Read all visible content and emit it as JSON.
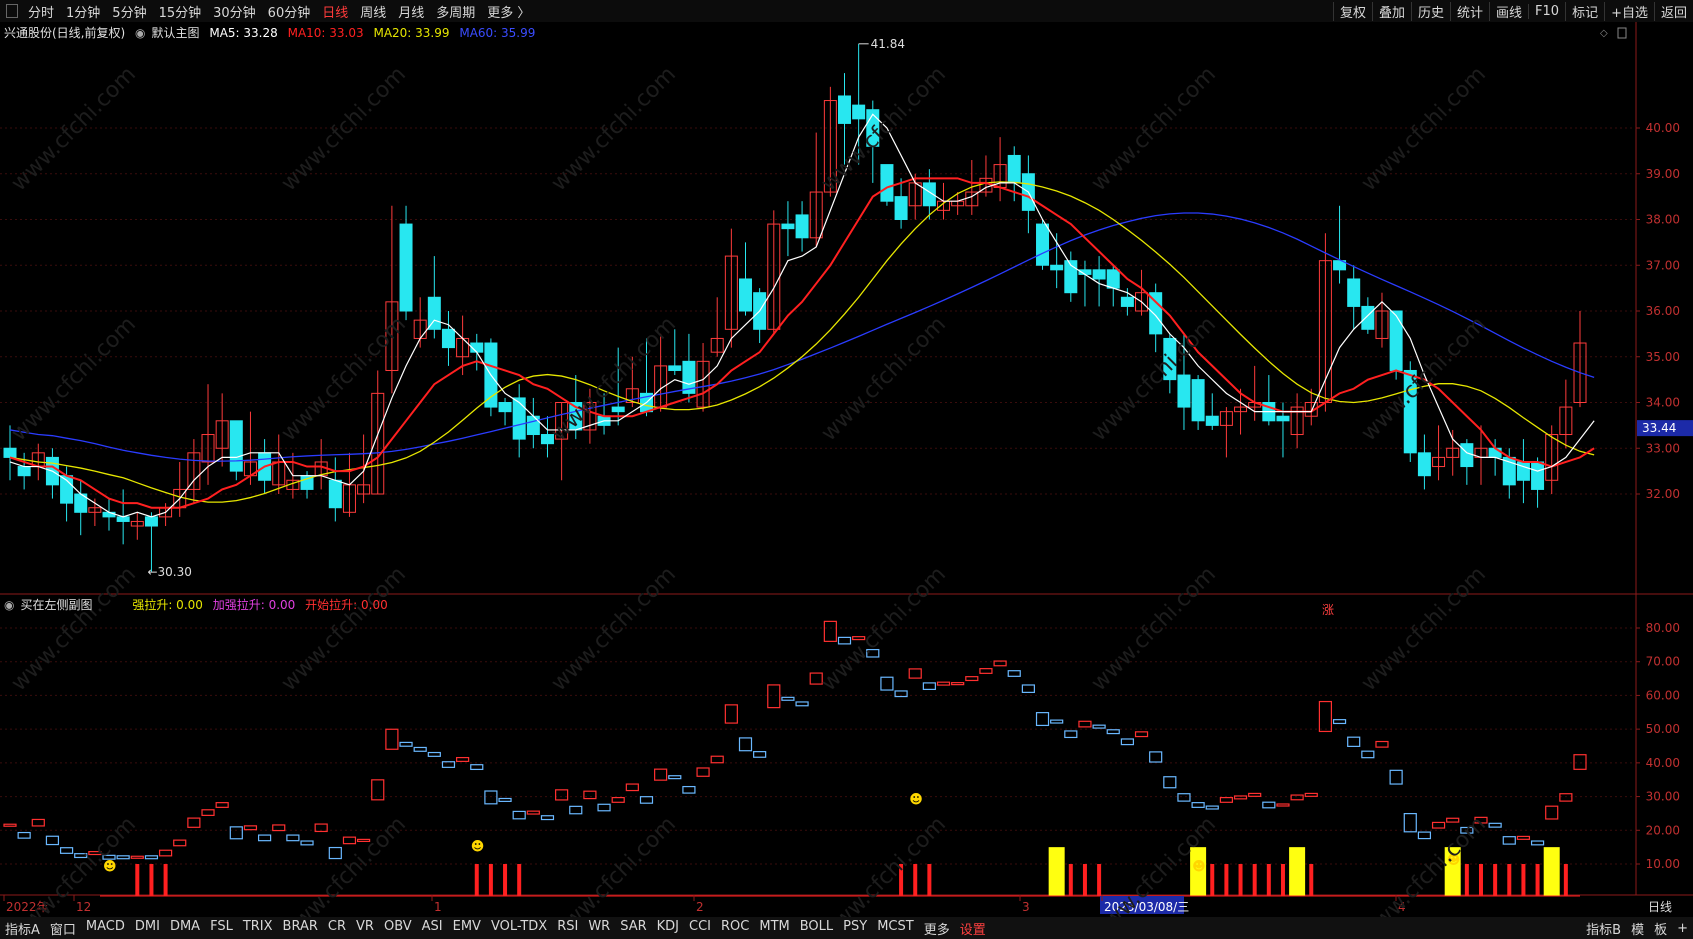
{
  "toolbar": {
    "timeframes": [
      "分时",
      "1分钟",
      "5分钟",
      "15分钟",
      "30分钟",
      "60分钟",
      "日线",
      "周线",
      "月线",
      "多周期",
      "更多 〉"
    ],
    "active": "日线",
    "right_buttons": [
      "复权",
      "叠加",
      "历史",
      "统计",
      "画线",
      "F10",
      "标记",
      "+自选",
      "返回"
    ]
  },
  "main_chart": {
    "stock_title": "兴通股份(日线,前复权)",
    "template": "默认主图",
    "ma5": "MA5: 33.28",
    "ma10": "MA10: 33.03",
    "ma20": "MA20: 33.99",
    "ma60": "MA60: 35.99",
    "high_label": "41.84",
    "low_label": "←30.30",
    "current_price": "33.44",
    "zhang": "涨",
    "y_ticks": [
      "40.00",
      "39.00",
      "38.00",
      "37.00",
      "36.00",
      "35.00",
      "34.00",
      "33.00",
      "32.00"
    ],
    "colors": {
      "up": "#ff3b3b",
      "down": "#28e7f0",
      "ma5": "#ffffff",
      "ma10": "#ff2020",
      "ma20": "#e6e600",
      "ma60": "#2a3cff"
    }
  },
  "sub_chart": {
    "title": "买在左侧副图",
    "strong": "强拉升: 0.00",
    "accel": "加强拉升: 0.00",
    "start": "开始拉升: 0.00",
    "y_ticks": [
      "80.00",
      "70.00",
      "60.00",
      "50.00",
      "40.00",
      "30.00",
      "20.00",
      "10.00"
    ]
  },
  "x_axis": {
    "labels": [
      "2022年",
      "12",
      "1",
      "2",
      "3",
      "2023/03/08/三",
      "4"
    ],
    "period": "日线"
  },
  "bottom_bar": {
    "indicators": [
      "指标A",
      "窗口",
      "MACD",
      "DMI",
      "DMA",
      "FSL",
      "TRIX",
      "BRAR",
      "CR",
      "VR",
      "OBV",
      "ASI",
      "EMV",
      "VOL-TDX",
      "RSI",
      "WR",
      "SAR",
      "KDJ",
      "CCI",
      "ROC",
      "MTM",
      "BOLL",
      "PSY",
      "MCST",
      "更多",
      "设置"
    ],
    "right": [
      "指标B",
      "模",
      "板",
      "+"
    ]
  },
  "watermark": "www.cfchi.com",
  "chart_data": {
    "type": "candlestick",
    "ylim": [
      31.0,
      42.5
    ],
    "candles": [
      [
        33.0,
        32.8,
        33.5,
        32.3
      ],
      [
        32.6,
        32.4,
        32.9,
        32.1
      ],
      [
        32.6,
        32.9,
        33.1,
        32.3
      ],
      [
        32.8,
        32.2,
        33.0,
        31.9
      ],
      [
        32.4,
        31.8,
        32.6,
        31.4
      ],
      [
        32.0,
        31.6,
        32.3,
        31.1
      ],
      [
        31.6,
        31.7,
        31.9,
        31.3
      ],
      [
        31.6,
        31.5,
        31.9,
        31.2
      ],
      [
        31.5,
        31.4,
        32.1,
        30.9
      ],
      [
        31.3,
        31.4,
        31.6,
        31.0
      ],
      [
        31.5,
        31.3,
        31.6,
        30.3
      ],
      [
        31.5,
        31.7,
        31.8,
        31.3
      ],
      [
        31.7,
        32.1,
        32.7,
        31.5
      ],
      [
        32.1,
        32.9,
        33.2,
        31.8
      ],
      [
        32.7,
        33.3,
        34.4,
        32.2
      ],
      [
        33.0,
        33.6,
        34.2,
        32.6
      ],
      [
        33.6,
        32.5,
        33.6,
        32.3
      ],
      [
        32.4,
        32.7,
        33.8,
        32.2
      ],
      [
        32.9,
        32.3,
        33.2,
        32.0
      ],
      [
        32.2,
        32.7,
        33.3,
        32.0
      ],
      [
        32.1,
        32.3,
        32.9,
        31.9
      ],
      [
        32.4,
        32.1,
        32.5,
        31.9
      ],
      [
        32.4,
        32.7,
        33.2,
        32.1
      ],
      [
        32.3,
        31.7,
        32.8,
        31.4
      ],
      [
        31.6,
        32.2,
        32.9,
        31.5
      ],
      [
        32.0,
        32.2,
        33.3,
        31.8
      ],
      [
        32.0,
        34.2,
        34.7,
        32.0
      ],
      [
        34.7,
        36.2,
        38.3,
        34.2
      ],
      [
        37.9,
        36.0,
        38.3,
        35.8
      ],
      [
        35.4,
        35.8,
        36.3,
        35.2
      ],
      [
        36.3,
        35.6,
        37.2,
        35.4
      ],
      [
        35.6,
        35.2,
        36.0,
        34.8
      ],
      [
        35.0,
        35.4,
        35.9,
        34.6
      ],
      [
        35.3,
        35.1,
        35.5,
        34.7
      ],
      [
        35.3,
        33.9,
        35.4,
        33.7
      ],
      [
        34.0,
        33.8,
        34.1,
        33.5
      ],
      [
        34.1,
        33.2,
        34.4,
        32.8
      ],
      [
        33.7,
        33.3,
        34.1,
        33.0
      ],
      [
        33.3,
        33.1,
        33.7,
        32.8
      ],
      [
        33.2,
        34.0,
        34.0,
        32.3
      ],
      [
        34.0,
        33.4,
        34.6,
        33.2
      ],
      [
        33.4,
        34.0,
        34.3,
        33.1
      ],
      [
        33.7,
        33.5,
        34.2,
        33.3
      ],
      [
        33.9,
        33.8,
        35.2,
        33.5
      ],
      [
        34.0,
        34.3,
        35.0,
        33.9
      ],
      [
        34.2,
        33.8,
        35.4,
        33.7
      ],
      [
        33.9,
        34.8,
        35.5,
        33.8
      ],
      [
        34.8,
        34.7,
        35.6,
        34.6
      ],
      [
        34.9,
        34.2,
        35.5,
        34.0
      ],
      [
        33.9,
        34.9,
        35.3,
        33.8
      ],
      [
        35.1,
        35.4,
        36.3,
        35.0
      ],
      [
        35.6,
        37.2,
        37.8,
        35.2
      ],
      [
        36.7,
        36.0,
        37.5,
        35.9
      ],
      [
        36.4,
        35.6,
        36.5,
        35.3
      ],
      [
        35.6,
        37.9,
        38.2,
        35.5
      ],
      [
        37.9,
        37.8,
        38.4,
        37.2
      ],
      [
        38.1,
        37.6,
        38.4,
        37.3
      ],
      [
        37.6,
        38.6,
        39.9,
        37.4
      ],
      [
        38.6,
        40.6,
        40.9,
        38.5
      ],
      [
        40.7,
        40.1,
        41.2,
        39.2
      ],
      [
        40.5,
        40.2,
        41.84,
        39.2
      ],
      [
        40.4,
        39.6,
        40.6,
        38.8
      ],
      [
        39.2,
        38.4,
        39.2,
        38.3
      ],
      [
        38.5,
        38.0,
        38.9,
        37.8
      ],
      [
        38.3,
        38.8,
        39.0,
        38.0
      ],
      [
        38.8,
        38.3,
        39.1,
        38.0
      ],
      [
        38.2,
        38.4,
        38.8,
        38.0
      ],
      [
        38.3,
        38.4,
        38.6,
        38.1
      ],
      [
        38.3,
        38.6,
        39.3,
        38.1
      ],
      [
        38.6,
        38.9,
        39.4,
        38.5
      ],
      [
        38.7,
        39.2,
        39.8,
        38.4
      ],
      [
        39.4,
        38.8,
        39.6,
        38.4
      ],
      [
        39.0,
        38.2,
        39.4,
        37.7
      ],
      [
        37.9,
        37.0,
        38.0,
        36.9
      ],
      [
        37.0,
        36.9,
        37.7,
        36.5
      ],
      [
        37.1,
        36.4,
        37.3,
        36.2
      ],
      [
        36.9,
        36.8,
        37.1,
        36.1
      ],
      [
        36.9,
        36.7,
        37.2,
        36.1
      ],
      [
        36.9,
        36.5,
        37.0,
        36.1
      ],
      [
        36.3,
        36.1,
        36.5,
        35.9
      ],
      [
        36.0,
        36.4,
        36.9,
        35.9
      ],
      [
        36.4,
        35.5,
        36.6,
        35.1
      ],
      [
        35.4,
        34.5,
        35.5,
        34.2
      ],
      [
        34.6,
        33.9,
        35.5,
        33.4
      ],
      [
        34.5,
        33.6,
        34.6,
        33.4
      ],
      [
        33.7,
        33.5,
        34.2,
        33.4
      ],
      [
        33.5,
        33.8,
        33.9,
        32.8
      ],
      [
        33.8,
        33.9,
        34.3,
        33.3
      ],
      [
        33.9,
        34.0,
        34.8,
        33.6
      ],
      [
        34.0,
        33.6,
        34.6,
        33.5
      ],
      [
        33.7,
        33.6,
        34.0,
        32.8
      ],
      [
        33.3,
        33.9,
        34.2,
        33.0
      ],
      [
        33.7,
        34.0,
        34.3,
        33.5
      ],
      [
        34.0,
        37.1,
        37.7,
        33.8
      ],
      [
        37.1,
        36.9,
        38.3,
        36.6
      ],
      [
        36.7,
        36.1,
        37.0,
        35.6
      ],
      [
        36.1,
        35.6,
        36.3,
        35.5
      ],
      [
        35.4,
        36.0,
        36.4,
        35.2
      ],
      [
        36.0,
        34.7,
        36.0,
        34.5
      ],
      [
        34.7,
        32.9,
        34.9,
        32.7
      ],
      [
        32.9,
        32.4,
        33.3,
        32.1
      ],
      [
        32.6,
        32.8,
        33.5,
        32.3
      ],
      [
        32.8,
        33.0,
        33.4,
        32.4
      ],
      [
        33.1,
        32.6,
        33.2,
        32.2
      ],
      [
        32.8,
        33.0,
        33.5,
        32.2
      ],
      [
        33.0,
        32.8,
        33.2,
        32.4
      ],
      [
        32.8,
        32.2,
        33.0,
        31.9
      ],
      [
        32.7,
        32.3,
        33.2,
        31.8
      ],
      [
        32.7,
        32.1,
        32.8,
        31.7
      ],
      [
        32.3,
        33.3,
        33.5,
        32.0
      ],
      [
        33.3,
        33.9,
        34.5,
        33.0
      ],
      [
        34.0,
        35.3,
        36.0,
        33.9
      ]
    ],
    "ma5": [
      32.7,
      32.6,
      32.6,
      32.5,
      32.3,
      32.0,
      31.8,
      31.6,
      31.5,
      31.6,
      31.5,
      31.6,
      31.9,
      32.3,
      32.6,
      32.8,
      32.8,
      32.9,
      32.9,
      32.9,
      32.4,
      32.4,
      32.4,
      32.3,
      32.2,
      32.5,
      33.3,
      34.1,
      34.8,
      35.4,
      35.8,
      35.7,
      35.4,
      35.1,
      34.6,
      34.2,
      34.0,
      33.7,
      33.4,
      33.4,
      33.4,
      33.5,
      33.6,
      33.6,
      33.8,
      34.0,
      34.3,
      34.5,
      34.4,
      34.5,
      34.8,
      35.4,
      35.7,
      36.0,
      36.5,
      37.1,
      37.2,
      37.4,
      38.2,
      39.0,
      39.8,
      40.3,
      40.0,
      39.4,
      38.8,
      38.6,
      38.4,
      38.4,
      38.5,
      38.7,
      38.8,
      38.8,
      38.6,
      38.0,
      37.5,
      37.0,
      36.8,
      36.6,
      36.5,
      36.4,
      36.2,
      35.9,
      35.5,
      35.2,
      34.8,
      34.5,
      34.2,
      34.0,
      33.8,
      33.8,
      33.8,
      33.8,
      33.8,
      34.5,
      35.2,
      35.6,
      35.9,
      36.2,
      35.9,
      35.4,
      34.6,
      33.9,
      33.2,
      32.9,
      32.8,
      32.8,
      32.7,
      32.6,
      32.5,
      32.6,
      32.8,
      33.2,
      33.6
    ],
    "ma10": [
      32.8,
      32.7,
      32.6,
      32.6,
      32.4,
      32.3,
      32.1,
      31.9,
      31.8,
      31.8,
      31.7,
      31.7,
      31.7,
      31.8,
      31.9,
      32.1,
      32.2,
      32.4,
      32.6,
      32.7,
      32.7,
      32.6,
      32.6,
      32.5,
      32.5,
      32.6,
      32.8,
      33.2,
      33.6,
      34.0,
      34.4,
      34.6,
      34.8,
      34.9,
      34.8,
      34.7,
      34.6,
      34.4,
      34.3,
      34.1,
      33.9,
      33.8,
      33.7,
      33.7,
      33.7,
      33.8,
      33.9,
      34.0,
      34.1,
      34.2,
      34.4,
      34.7,
      34.9,
      35.1,
      35.5,
      35.9,
      36.2,
      36.6,
      37.0,
      37.5,
      38.0,
      38.5,
      38.7,
      38.8,
      38.9,
      38.9,
      38.9,
      38.9,
      38.8,
      38.8,
      38.7,
      38.6,
      38.5,
      38.3,
      38.1,
      37.9,
      37.6,
      37.3,
      37.0,
      36.7,
      36.5,
      36.2,
      35.9,
      35.5,
      35.1,
      34.8,
      34.5,
      34.2,
      34.0,
      33.9,
      33.8,
      33.8,
      33.8,
      34.0,
      34.2,
      34.3,
      34.5,
      34.6,
      34.7,
      34.6,
      34.5,
      34.3,
      34.0,
      33.7,
      33.4,
      33.0,
      32.8,
      32.7,
      32.7,
      32.6,
      32.7,
      32.8,
      33.0
    ]
  }
}
